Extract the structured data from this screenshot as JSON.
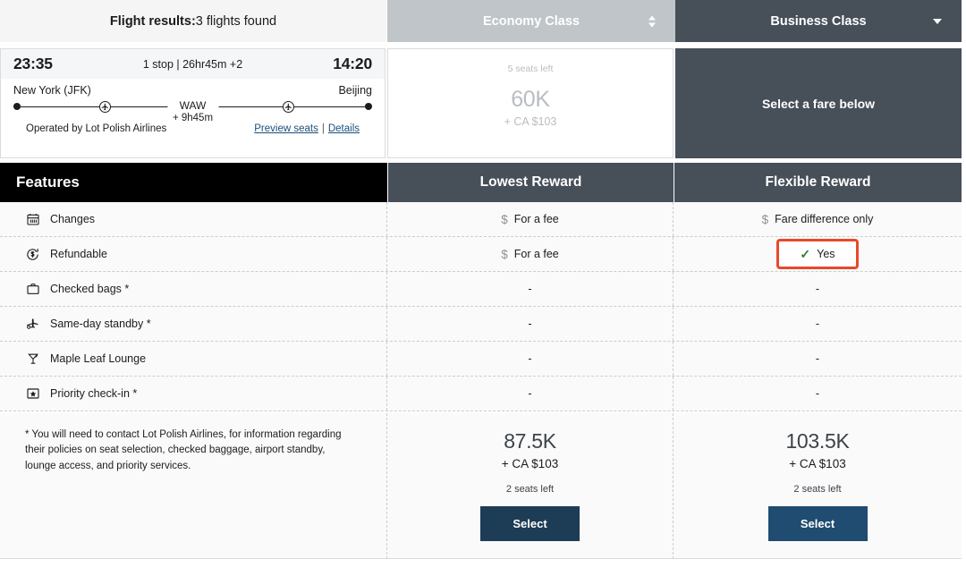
{
  "header": {
    "results_label": "Flight results:",
    "results_count": "3 flights found",
    "tabs": [
      {
        "label": "Economy Class",
        "icon": "stepper-updown-icon"
      },
      {
        "label": "Business Class",
        "icon": "chevron-down-icon"
      }
    ]
  },
  "flight": {
    "depart_time": "23:35",
    "summary": "1 stop | 26hr45m +2",
    "arrive_time": "14:20",
    "origin": "New York (JFK)",
    "destination": "Beijing",
    "stop_code": "WAW",
    "stop_duration": "+ 9h45m",
    "operated_by": "Operated by Lot Polish Airlines",
    "link_preview": "Preview seats",
    "link_separator": "|",
    "link_details": "Details"
  },
  "fare_cards": {
    "economy": {
      "seats_left": "5 seats left",
      "miles": "60K",
      "tax": "+ CA $103"
    },
    "business": {
      "prompt": "Select a fare below"
    }
  },
  "table": {
    "features_header": "Features",
    "columns": [
      "Lowest Reward",
      "Flexible Reward"
    ],
    "rows": [
      {
        "icon": "calendar-icon",
        "label": "Changes",
        "lowest": "For a fee",
        "lowest_icon": "dollar-icon",
        "flexible": "Fare difference only",
        "flexible_icon": "dollar-icon",
        "highlight": false
      },
      {
        "icon": "refund-dollar-icon",
        "label": "Refundable",
        "lowest": "For a fee",
        "lowest_icon": "dollar-icon",
        "flexible": "Yes",
        "flexible_icon": "check-icon",
        "highlight": true
      },
      {
        "icon": "briefcase-icon",
        "label": "Checked bags *",
        "lowest": "-",
        "lowest_icon": "",
        "flexible": "-",
        "flexible_icon": "",
        "highlight": false
      },
      {
        "icon": "standby-plane-icon",
        "label": "Same-day standby *",
        "lowest": "-",
        "lowest_icon": "",
        "flexible": "-",
        "flexible_icon": "",
        "highlight": false
      },
      {
        "icon": "lounge-glass-icon",
        "label": "Maple Leaf Lounge",
        "lowest": "-",
        "lowest_icon": "",
        "flexible": "-",
        "flexible_icon": "",
        "highlight": false
      },
      {
        "icon": "star-box-icon",
        "label": "Priority check-in *",
        "lowest": "-",
        "lowest_icon": "",
        "flexible": "-",
        "flexible_icon": "",
        "highlight": false
      }
    ]
  },
  "footer": {
    "note": "* You will need to contact Lot Polish Airlines, for information regarding their policies on seat selection, checked baggage, airport standby, lounge access, and priority services.",
    "prices": [
      {
        "miles": "87.5K",
        "tax": "+ CA $103",
        "seats_left": "2 seats left",
        "button": "Select",
        "button_color": "#1d3c56"
      },
      {
        "miles": "103.5K",
        "tax": "+ CA $103",
        "seats_left": "2 seats left",
        "button": "Select",
        "button_color": "#1f4c70"
      }
    ]
  },
  "colors": {
    "features_header_bg": "#000000",
    "reward_header_bg": "#474f59",
    "economy_tab_bg": "#bfc5c9",
    "business_tab_bg": "#474f59",
    "highlight_border": "#e8492a",
    "check_green": "#2f7d32",
    "link_blue": "#1a4f7a"
  }
}
